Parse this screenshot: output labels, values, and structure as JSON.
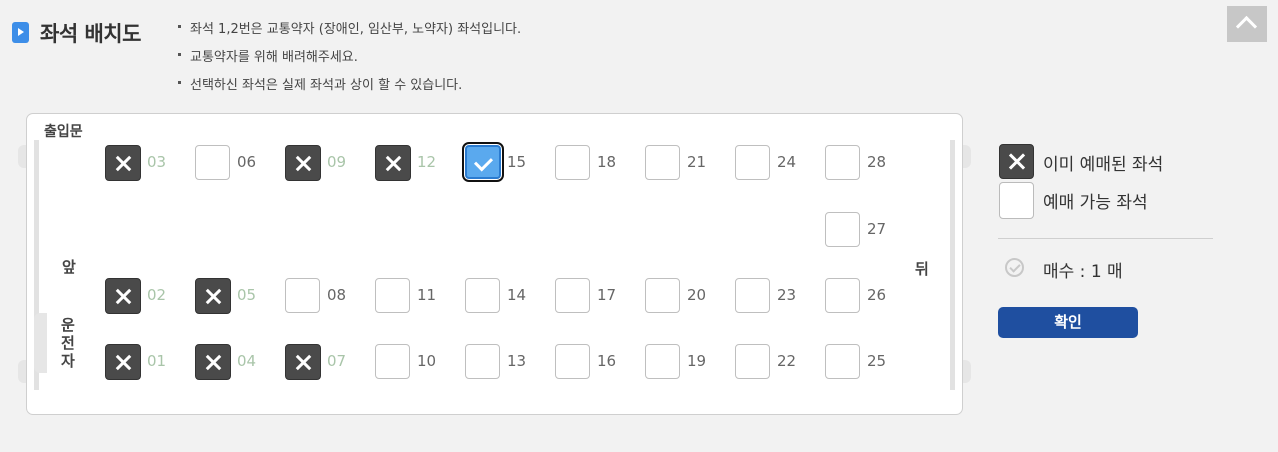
{
  "header": {
    "title": "좌석 배치도",
    "notices": [
      "좌석 1,2번은 교통약자 (장애인, 임산부, 노약자) 좌석입니다.",
      "교통약자를 위해 배려해주세요.",
      "선택하신 좌석은 실제 좌석과 상이 할 수 있습니다."
    ]
  },
  "bus": {
    "door_label": "출입문",
    "front_label": "앞",
    "back_label": "뒤",
    "driver_label": "운전자"
  },
  "seats": [
    {
      "num": "03",
      "status": "sold"
    },
    {
      "num": "06",
      "status": "available"
    },
    {
      "num": "09",
      "status": "sold"
    },
    {
      "num": "12",
      "status": "sold"
    },
    {
      "num": "15",
      "status": "selected"
    },
    {
      "num": "18",
      "status": "available"
    },
    {
      "num": "21",
      "status": "available"
    },
    {
      "num": "24",
      "status": "available"
    },
    {
      "num": "28",
      "status": "available"
    },
    {
      "num": "27",
      "status": "available"
    },
    {
      "num": "02",
      "status": "sold"
    },
    {
      "num": "05",
      "status": "sold"
    },
    {
      "num": "08",
      "status": "available"
    },
    {
      "num": "11",
      "status": "available"
    },
    {
      "num": "14",
      "status": "available"
    },
    {
      "num": "17",
      "status": "available"
    },
    {
      "num": "20",
      "status": "available"
    },
    {
      "num": "23",
      "status": "available"
    },
    {
      "num": "26",
      "status": "available"
    },
    {
      "num": "01",
      "status": "sold"
    },
    {
      "num": "04",
      "status": "sold"
    },
    {
      "num": "07",
      "status": "sold"
    },
    {
      "num": "10",
      "status": "available"
    },
    {
      "num": "13",
      "status": "available"
    },
    {
      "num": "16",
      "status": "available"
    },
    {
      "num": "19",
      "status": "available"
    },
    {
      "num": "22",
      "status": "available"
    },
    {
      "num": "25",
      "status": "available"
    }
  ],
  "legend": {
    "sold_label": "이미 예매된 좌석",
    "available_label": "예매 가능 좌석"
  },
  "summary": {
    "count_text": "매수 : 1 매",
    "confirm_label": "확인"
  },
  "colors": {
    "confirm_button": "#1f4fa0",
    "selected_seat": "#5aa9ee",
    "sold_seat": "#4a4a4a"
  }
}
